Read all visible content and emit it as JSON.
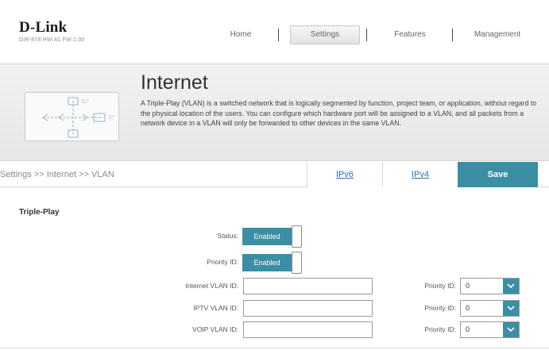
{
  "brand": {
    "logo": "D-Link",
    "model": "DIR-878 HW:A1 FW:1.00"
  },
  "nav": {
    "items": [
      "Home",
      "Settings",
      "Features",
      "Management"
    ],
    "active": "Settings"
  },
  "banner": {
    "title": "Internet",
    "description": "A Triple-Play (VLAN) is a switched network that is logically segmented by function, project team, or application, without regard to the physical location of the users. You can configure which hardware port will be assigned to a VLAN, and all packets from a network device in a VLAN will only be forwarded to other devices in the same VLAN.",
    "icon": "network-diagram-icon"
  },
  "toolbar": {
    "breadcrumb": "Settings >> Internet >> VLAN",
    "ipv6": "IPv6",
    "ipv4": "IPv4",
    "save": "Save"
  },
  "triple_play": {
    "title": "Triple-Play",
    "status_label": "Status:",
    "status_value": "Enabled",
    "priority_label": "Priority ID:",
    "priority_value": "Enabled",
    "rows": [
      {
        "label": "Internet VLAN ID:",
        "value": "",
        "priority_label": "Priority ID:",
        "priority_value": "0"
      },
      {
        "label": "IPTV VLAN ID:",
        "value": "",
        "priority_label": "Priority ID:",
        "priority_value": "0"
      },
      {
        "label": "VOIP VLAN ID:",
        "value": "",
        "priority_label": "Priority ID:",
        "priority_value": "0"
      }
    ]
  },
  "colors": {
    "accent": "#3a8fa4",
    "link": "#2f6fb4"
  }
}
